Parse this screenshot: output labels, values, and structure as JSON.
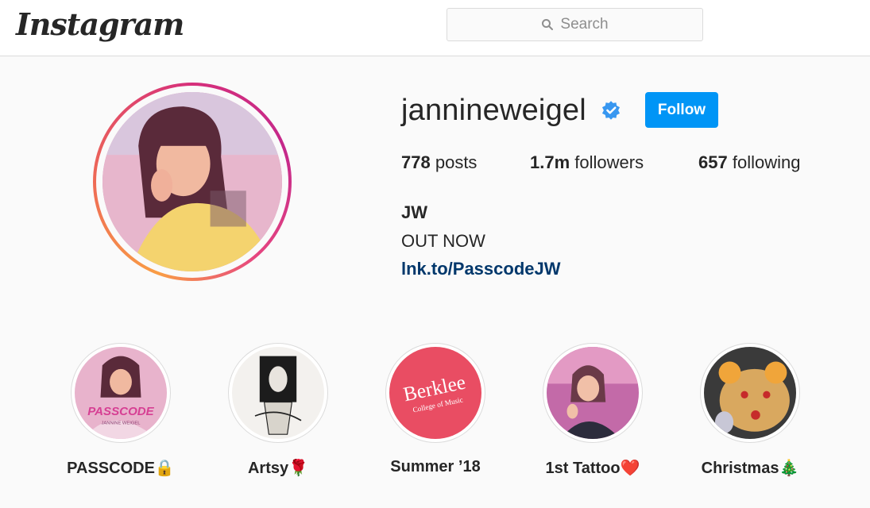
{
  "header": {
    "logo_text": "Instagram",
    "search": {
      "placeholder": "Search"
    }
  },
  "profile": {
    "username": "jannineweigel",
    "verified": true,
    "follow_label": "Follow",
    "stats": {
      "posts": {
        "value": "778",
        "label": "posts"
      },
      "followers": {
        "value": "1.7m",
        "label": "followers"
      },
      "following": {
        "value": "657",
        "label": "following"
      }
    },
    "bio": {
      "name": "JW",
      "text": "OUT NOW",
      "link": "lnk.to/PasscodeJW"
    }
  },
  "highlights": [
    {
      "label": "PASSCODE🔒",
      "thumb_text": "PASSCODE",
      "thumb_subtext": "JANNINE WEIGEL"
    },
    {
      "label": "Artsy🌹"
    },
    {
      "label": "Summer ’18",
      "thumb_text": "Berklee",
      "thumb_subtext": "College of Music"
    },
    {
      "label": "1st Tattoo❤️"
    },
    {
      "label": "Christmas🎄"
    }
  ],
  "colors": {
    "accent": "#0095f6",
    "link": "#00376b",
    "text": "#262626",
    "muted": "#8e8e8e",
    "border": "#dbdbdb",
    "background": "#fafafa"
  }
}
